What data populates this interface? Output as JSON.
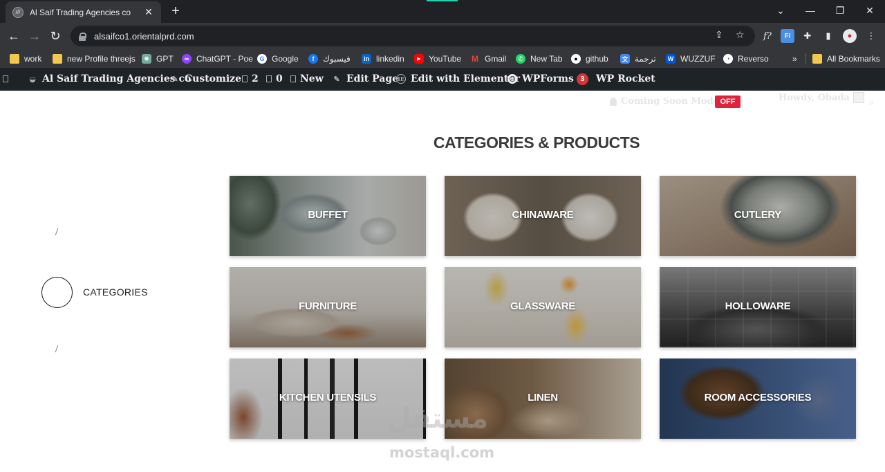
{
  "browser": {
    "tab_title": "Al Saif Trading Agencies co",
    "tab_close": "✕",
    "new_tab": "+",
    "url": "alsaifco1.orientalprd.com",
    "win_min": "—",
    "win_max": "❐",
    "win_close": "✕",
    "tab_search": "⌄",
    "back": "←",
    "forward": "→",
    "reload": "↻"
  },
  "bookmarks": [
    {
      "label": "work",
      "icon": "folder-icon"
    },
    {
      "label": "new Profile threejs",
      "icon": "folder-icon"
    },
    {
      "label": "GPT",
      "icon": "chatgpt-icon"
    },
    {
      "label": "ChatGPT - Poe",
      "icon": "poe-icon"
    },
    {
      "label": "Google",
      "icon": "google-icon"
    },
    {
      "label": "فيسبوك",
      "icon": "facebook-icon"
    },
    {
      "label": "linkedin",
      "icon": "linkedin-icon"
    },
    {
      "label": "YouTube",
      "icon": "youtube-icon"
    },
    {
      "label": "Gmail",
      "icon": "gmail-icon"
    },
    {
      "label": "New Tab",
      "icon": "whatsapp-icon"
    },
    {
      "label": "github",
      "icon": "github-icon"
    },
    {
      "label": "ترجمة",
      "icon": "translate-icon"
    },
    {
      "label": "WUZZUF",
      "icon": "wuzzuf-icon"
    },
    {
      "label": "Reverso",
      "icon": "reverso-icon"
    }
  ],
  "bookmarks_more": "»",
  "all_bookmarks": "All Bookmarks",
  "wp_admin": {
    "site_name": "Al Saif Trading Agencies co",
    "customize": "Customize",
    "comments_count": "2",
    "updates_count": "0",
    "new": "New",
    "edit_page": "Edit Page",
    "edit_elementor": "Edit with Elementor",
    "wpforms": "WPForms",
    "wpforms_badge": "3",
    "wp_rocket": "WP Rocket",
    "coming_soon": "Coming Soon Mode",
    "coming_soon_state": "OFF",
    "howdy": "Howdy, Obada"
  },
  "page": {
    "title": "CATEGORIES & PRODUCTS",
    "side_label": "CATEGORIES",
    "slash": "/"
  },
  "categories": [
    {
      "label": "BUFFET"
    },
    {
      "label": "CHINAWARE"
    },
    {
      "label": "CUTLERY"
    },
    {
      "label": "FURNITURE"
    },
    {
      "label": "GLASSWARE"
    },
    {
      "label": "HOLLOWARE"
    },
    {
      "label": "KITCHEN UTENSILS"
    },
    {
      "label": "LINEN"
    },
    {
      "label": "ROOM ACCESSORIES"
    }
  ],
  "watermark": {
    "arabic": "مستقل",
    "latin": "mostaql.com"
  }
}
